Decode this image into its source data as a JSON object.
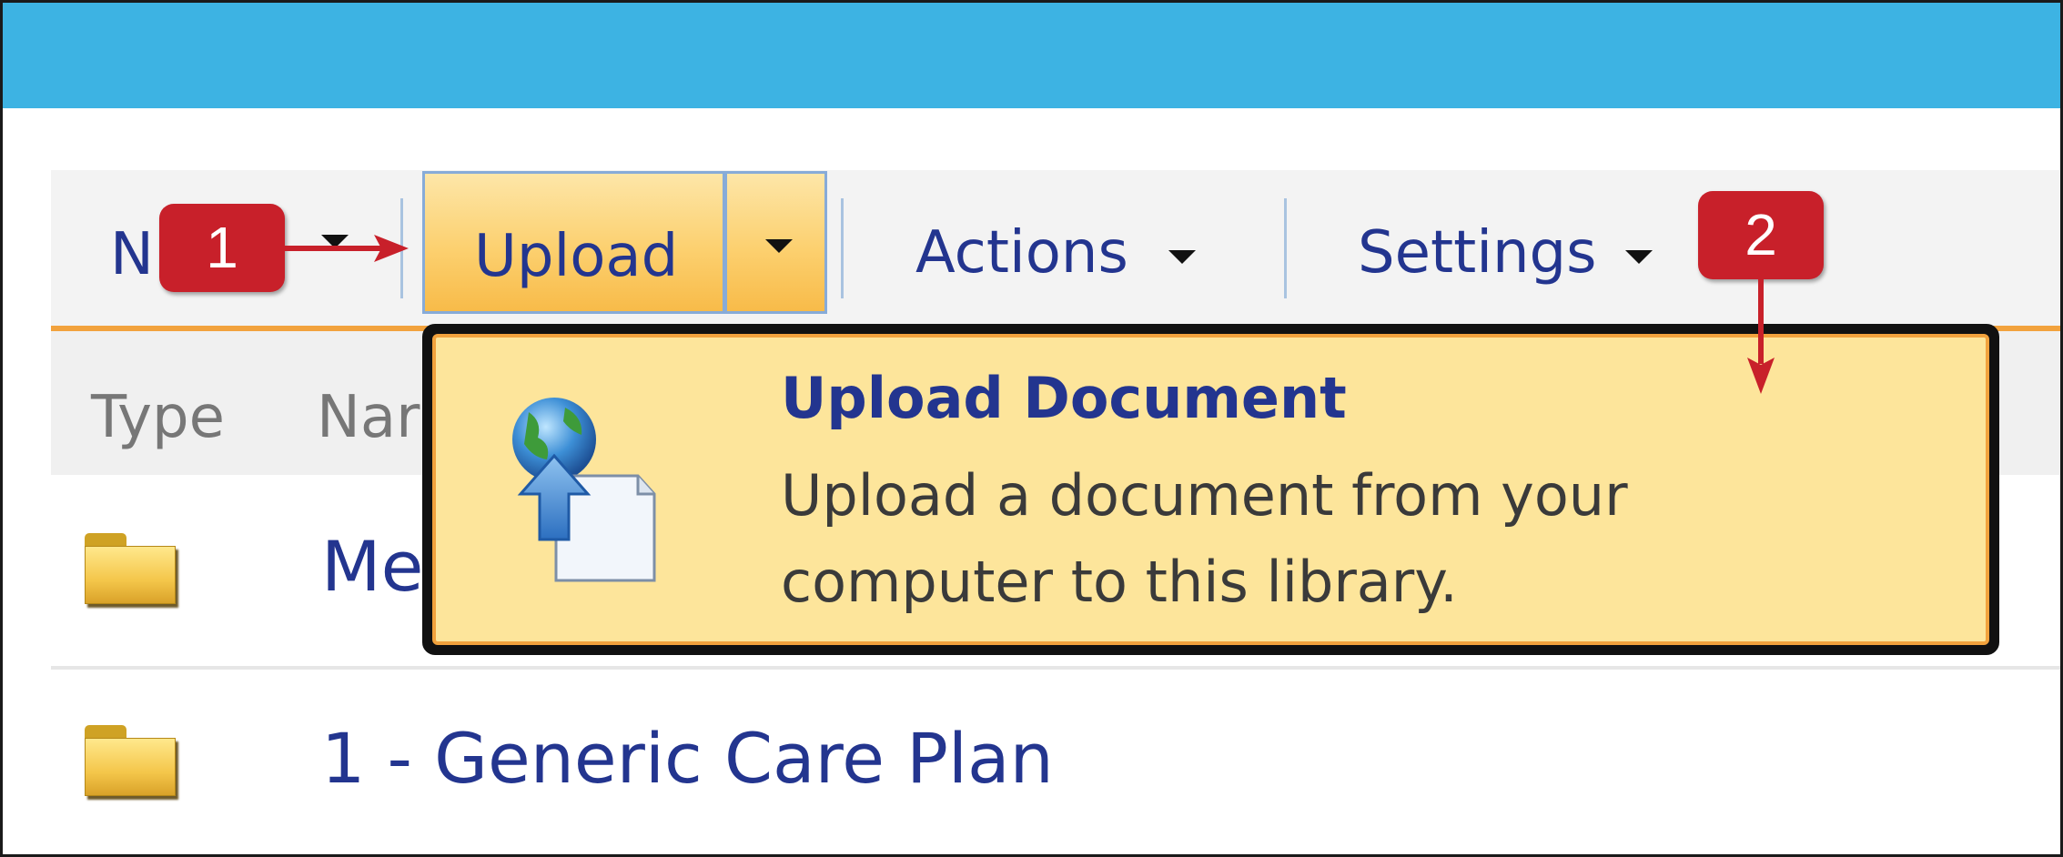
{
  "toolbar": {
    "new_label_partial": "N",
    "upload_label": "Upload",
    "actions_label": "Actions",
    "settings_label": "Settings"
  },
  "list": {
    "columns": [
      "Type",
      "Nar"
    ],
    "rows": [
      {
        "name": "Me"
      },
      {
        "name": "1 - Generic Care Plan"
      }
    ]
  },
  "upload_menu": {
    "item_title": "Upload Document",
    "item_description_line1": "Upload a document from your",
    "item_description_line2": "computer to this library.",
    "icon": "upload-document-icon"
  },
  "callouts": [
    {
      "label": "1"
    },
    {
      "label": "2"
    }
  ],
  "colors": {
    "banner": "#3db3e3",
    "accent_orange": "#f2a23d",
    "link_blue": "#23358f",
    "callout_red": "#c8202a",
    "popup_bg": "#fde59b"
  }
}
